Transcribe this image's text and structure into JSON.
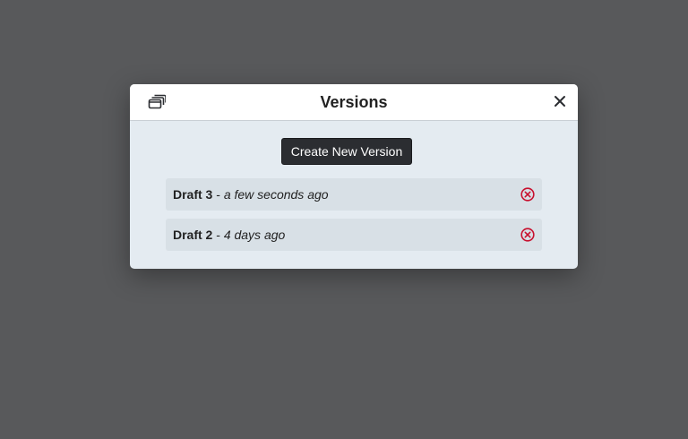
{
  "modal": {
    "title": "Versions",
    "header_icon": "stacked-windows-icon",
    "close_icon": "close-icon",
    "create_button_label": "Create New Version"
  },
  "versions": [
    {
      "name": "Draft 3",
      "separator": " - ",
      "time": "a few seconds ago",
      "delete_icon": "circle-x-icon"
    },
    {
      "name": "Draft 2",
      "separator": " - ",
      "time": "4 days ago",
      "delete_icon": "circle-x-icon"
    }
  ],
  "colors": {
    "backdrop": "#58595b",
    "modal_body": "#e4ebf1",
    "button_bg": "#2b2d31",
    "delete_red": "#c8102e"
  }
}
